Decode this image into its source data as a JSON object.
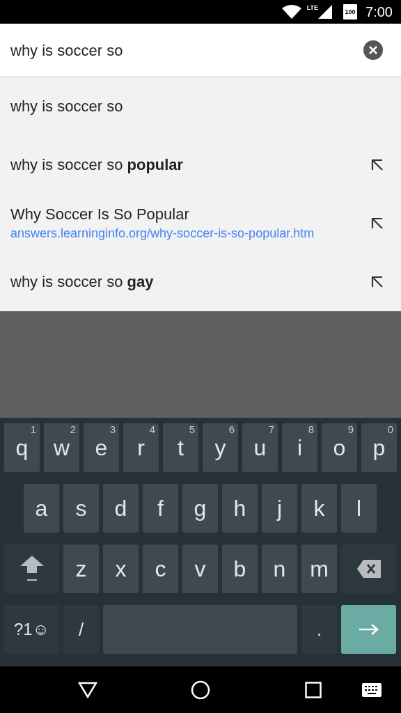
{
  "status_bar": {
    "network": "LTE",
    "battery": "100",
    "time": "7:00"
  },
  "search": {
    "value": "why is soccer so"
  },
  "suggestions": [
    {
      "kind": "query",
      "text": "why is soccer so",
      "refine": false
    },
    {
      "kind": "query",
      "text": "why is soccer so **popular**",
      "refine": true
    },
    {
      "kind": "page",
      "text": "Why Soccer Is So Popular",
      "url": "answers.learninginfo.org/why-soccer-is-so-popular.htm",
      "refine": true
    },
    {
      "kind": "query",
      "text": "why is soccer so **gay**",
      "refine": true
    }
  ],
  "keyboard": {
    "rows": [
      {
        "keys": [
          {
            "kind": "letter",
            "label": "q",
            "hint": "1"
          },
          {
            "kind": "letter",
            "label": "w",
            "hint": "2"
          },
          {
            "kind": "letter",
            "label": "e",
            "hint": "3"
          },
          {
            "kind": "letter",
            "label": "r",
            "hint": "4"
          },
          {
            "kind": "letter",
            "label": "t",
            "hint": "5"
          },
          {
            "kind": "letter",
            "label": "y",
            "hint": "6"
          },
          {
            "kind": "letter",
            "label": "u",
            "hint": "7"
          },
          {
            "kind": "letter",
            "label": "i",
            "hint": "8"
          },
          {
            "kind": "letter",
            "label": "o",
            "hint": "9"
          },
          {
            "kind": "letter",
            "label": "p",
            "hint": "0"
          }
        ]
      },
      {
        "keys": [
          {
            "kind": "letter",
            "label": "a"
          },
          {
            "kind": "letter",
            "label": "s"
          },
          {
            "kind": "letter",
            "label": "d"
          },
          {
            "kind": "letter",
            "label": "f"
          },
          {
            "kind": "letter",
            "label": "g"
          },
          {
            "kind": "letter",
            "label": "h"
          },
          {
            "kind": "letter",
            "label": "j"
          },
          {
            "kind": "letter",
            "label": "k"
          },
          {
            "kind": "letter",
            "label": "l"
          }
        ]
      },
      {
        "keys": [
          {
            "kind": "shift"
          },
          {
            "kind": "letter",
            "label": "z"
          },
          {
            "kind": "letter",
            "label": "x"
          },
          {
            "kind": "letter",
            "label": "c"
          },
          {
            "kind": "letter",
            "label": "v"
          },
          {
            "kind": "letter",
            "label": "b"
          },
          {
            "kind": "letter",
            "label": "n"
          },
          {
            "kind": "letter",
            "label": "m"
          },
          {
            "kind": "backspace"
          }
        ]
      },
      {
        "keys": [
          {
            "kind": "symbols",
            "label": "?1☺"
          },
          {
            "kind": "function",
            "label": "/"
          },
          {
            "kind": "space"
          },
          {
            "kind": "function",
            "label": "."
          },
          {
            "kind": "enter"
          }
        ]
      }
    ]
  }
}
